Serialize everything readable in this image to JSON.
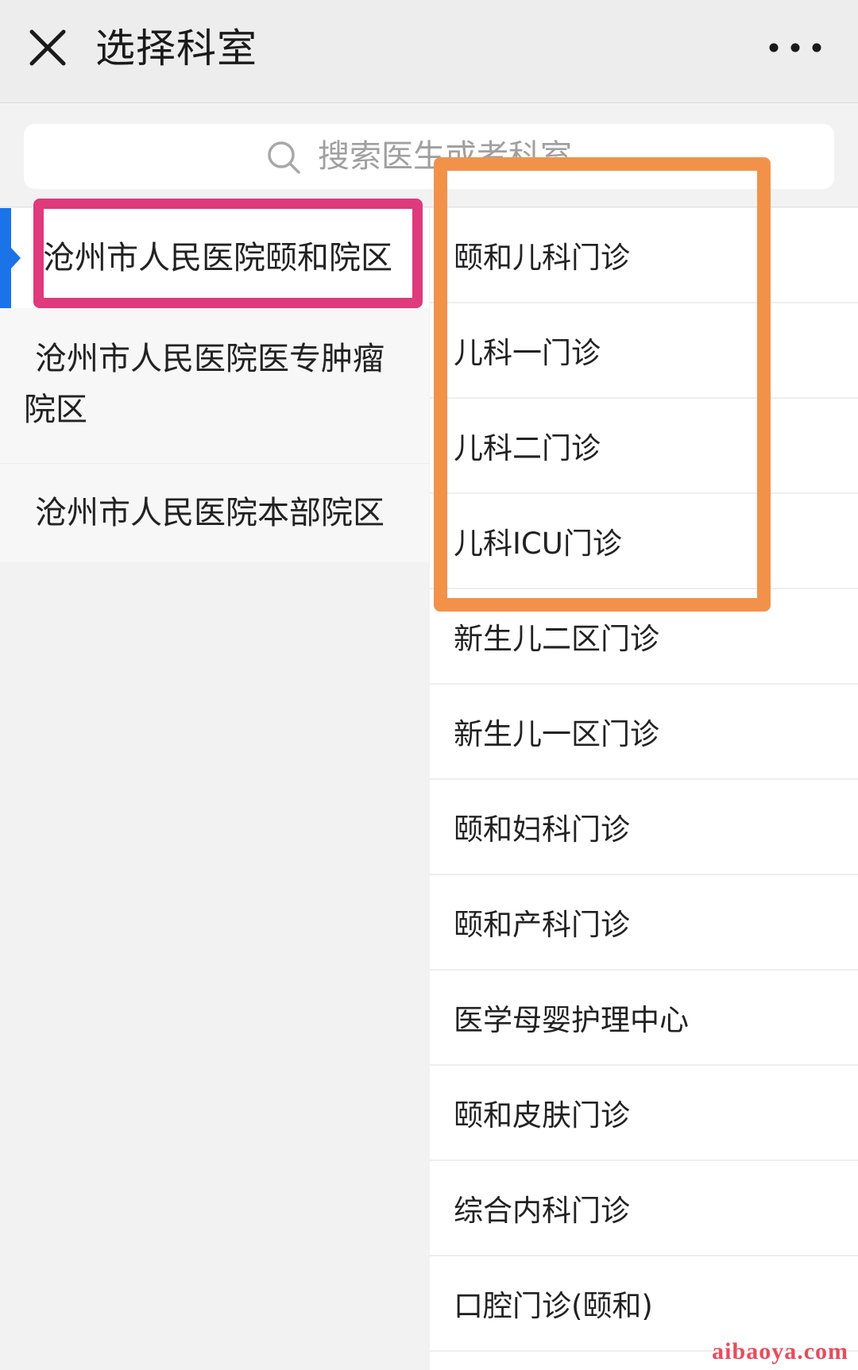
{
  "header": {
    "title": "选择科室",
    "close_icon": "close-icon",
    "more_icon": "more-icon"
  },
  "search": {
    "placeholder": "搜索医生或者科室",
    "icon": "search-icon"
  },
  "campuses": [
    {
      "label": "沧州市人民医院颐和院区",
      "selected": true
    },
    {
      "label": "沧州市人民医院医专肿瘤院区",
      "selected": false
    },
    {
      "label": "沧州市人民医院本部院区",
      "selected": false
    }
  ],
  "departments": [
    {
      "label": "颐和儿科门诊"
    },
    {
      "label": "儿科一门诊"
    },
    {
      "label": "儿科二门诊"
    },
    {
      "label": "儿科ICU门诊"
    },
    {
      "label": "新生儿二区门诊"
    },
    {
      "label": "新生儿一区门诊"
    },
    {
      "label": "颐和妇科门诊"
    },
    {
      "label": "颐和产科门诊"
    },
    {
      "label": "医学母婴护理中心"
    },
    {
      "label": "颐和皮肤门诊"
    },
    {
      "label": "综合内科门诊"
    },
    {
      "label": "口腔门诊(颐和)"
    }
  ],
  "colors": {
    "accent": "#1a73e8",
    "highlight_pink": "#de3a7c",
    "highlight_orange": "#f2924a",
    "watermark": "#e94b5d"
  },
  "watermark": "aibaoya.com"
}
